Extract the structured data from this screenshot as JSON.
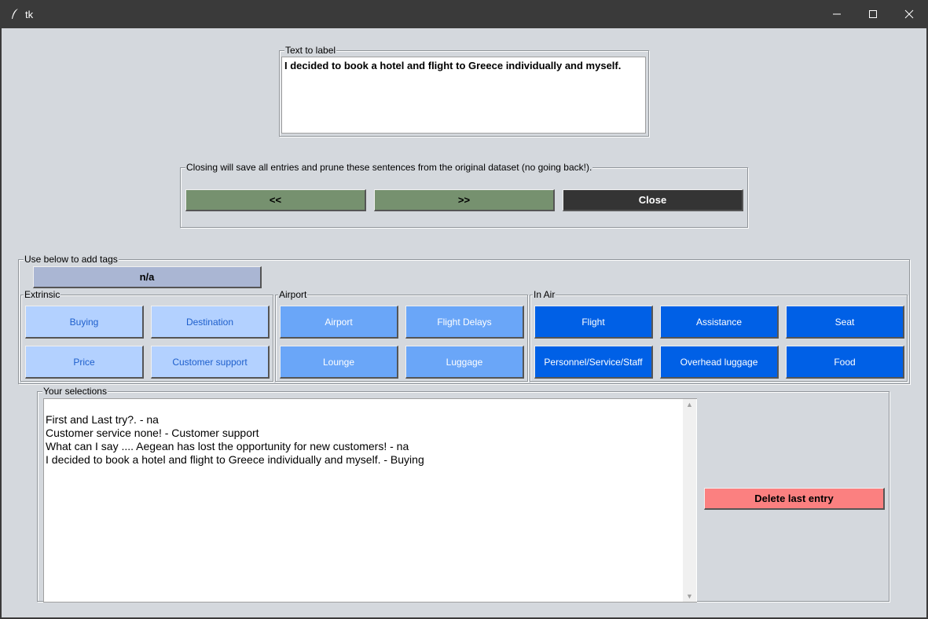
{
  "window": {
    "title": "tk"
  },
  "text_frame": {
    "label": "Text to label",
    "text": "I decided to book a hotel and flight to Greece individually and myself."
  },
  "nav_frame": {
    "label": "Closing will save all entries and prune these sentences from the original dataset (no going back!).",
    "prev_label": "<<",
    "next_label": ">>",
    "close_label": "Close"
  },
  "tags_frame": {
    "label": "Use below to add tags",
    "na_label": "n/a",
    "extrinsic": {
      "label": "Extrinsic",
      "buttons": [
        "Buying",
        "Destination",
        "Price",
        "Customer support"
      ]
    },
    "airport": {
      "label": "Airport",
      "buttons": [
        "Airport",
        "Flight Delays",
        "Lounge",
        "Luggage"
      ]
    },
    "in_air": {
      "label": "In Air",
      "buttons": [
        "Flight",
        "Assistance",
        "Seat",
        "Personnel/Service/Staff",
        "Overhead luggage",
        "Food"
      ]
    }
  },
  "selections_frame": {
    "label": "Your selections",
    "lines": [
      "First and Last try?. - na",
      "Customer service none! - Customer support",
      "What can I say .... Aegean has lost the opportunity for new customers! - na",
      "I decided to book a hotel and flight to Greece individually and myself. - Buying"
    ],
    "delete_label": "Delete last entry"
  },
  "colors": {
    "nav": "#76916f",
    "close": "#343434",
    "na": "#aab6d3",
    "extrinsic": "#b3d1ff",
    "airport": "#6aa6f8",
    "in_air": "#0060e6",
    "delete": "#fb8080"
  },
  "icons": [
    "feather-icon",
    "minimize-icon",
    "maximize-icon",
    "close-window-icon"
  ]
}
